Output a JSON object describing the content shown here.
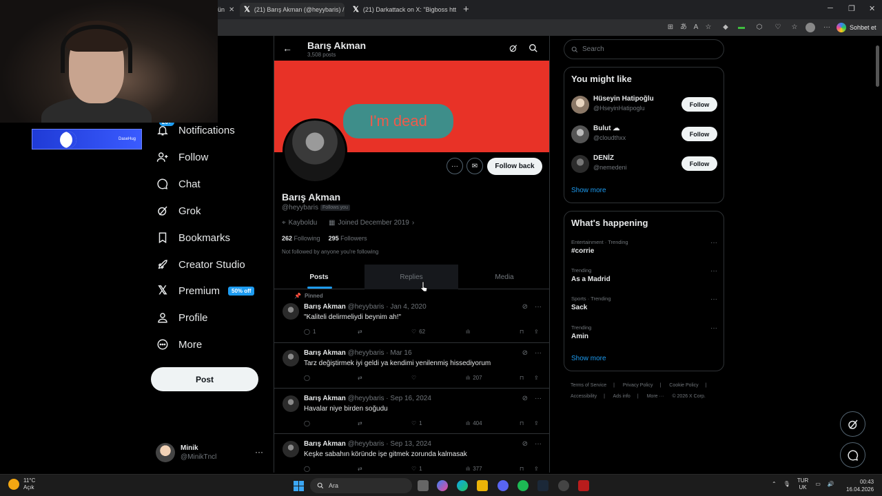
{
  "browser": {
    "tabs": [
      {
        "label": "ün"
      },
      {
        "label": "(21) Barış Akman (@heyybaris) / X"
      },
      {
        "label": "(21) Darkattack on X: \"Bigboss htt"
      }
    ],
    "copilot_label": "Sohbet et"
  },
  "stream_banner": {
    "text": "DaseHug"
  },
  "nav": {
    "notifications_badge": "20+",
    "items": [
      {
        "label": "Notifications",
        "icon": "bell-icon"
      },
      {
        "label": "Follow",
        "icon": "person-plus-icon"
      },
      {
        "label": "Chat",
        "icon": "chat-bubble-icon"
      },
      {
        "label": "Grok",
        "icon": "grok-icon"
      },
      {
        "label": "Bookmarks",
        "icon": "bookmark-icon"
      },
      {
        "label": "Creator Studio",
        "icon": "rocket-icon"
      },
      {
        "label": "Premium",
        "icon": "x-logo-icon"
      },
      {
        "label": "Profile",
        "icon": "person-icon"
      },
      {
        "label": "More",
        "icon": "more-circle-icon"
      }
    ],
    "premium_promo": "50% off",
    "post_label": "Post",
    "account": {
      "name": "Minik",
      "handle": "@MinikTncl"
    }
  },
  "profile": {
    "header_name": "Barış Akman",
    "header_posts": "3,508 posts",
    "banner_text": "I'm dead",
    "follow_back_label": "Follow back",
    "name": "Barış Akman",
    "handle": "@heyybaris",
    "follows_you": "Follows you",
    "location": "Kayboldu",
    "joined": "Joined December 2019",
    "following_count": "262",
    "following_label": "Following",
    "followers_count": "295",
    "followers_label": "Followers",
    "not_followed": "Not followed by anyone you're following",
    "tabs": [
      "Posts",
      "Replies",
      "Media"
    ]
  },
  "posts": [
    {
      "pinned": "Pinned",
      "name": "Barış Akman",
      "handle": "@heyybaris",
      "date": "· Jan 4, 2020",
      "text": "\"Kaliteli delirmeliydi beynim ah!\"",
      "replies": "1",
      "likes": "62",
      "views": ""
    },
    {
      "name": "Barış Akman",
      "handle": "@heyybaris",
      "date": "· Mar 16",
      "text": "Tarz değiştirmek iyi geldi ya kendimi yenilenmiş hissediyorum",
      "replies": "",
      "likes": "",
      "views": "207"
    },
    {
      "name": "Barış Akman",
      "handle": "@heyybaris",
      "date": "· Sep 16, 2024",
      "text": "Havalar niye birden soğudu",
      "replies": "",
      "likes": "1",
      "views": "404"
    },
    {
      "name": "Barış Akman",
      "handle": "@heyybaris",
      "date": "· Sep 13, 2024",
      "text": "Keşke sabahın köründe işe gitmek zorunda kalmasak",
      "replies": "",
      "likes": "1",
      "views": "377"
    }
  ],
  "right": {
    "search_placeholder": "Search",
    "might_like_title": "You might like",
    "suggestions": [
      {
        "name": "Hüseyin Hatipoğlu",
        "handle": "@HseyinHatipoglu",
        "button": "Follow"
      },
      {
        "name": "Bulut ☁",
        "handle": "@cloudthxx",
        "button": "Follow"
      },
      {
        "name": "DENİZ",
        "handle": "@nemedeni",
        "button": "Follow"
      }
    ],
    "show_more": "Show more",
    "happening_title": "What's happening",
    "trends": [
      {
        "context": "Entertainment · Trending",
        "name": "#corrie"
      },
      {
        "context": "Trending",
        "name": "As a Madrid"
      },
      {
        "context": "Sports · Trending",
        "name": "Sack"
      },
      {
        "context": "Trending",
        "name": "Amin"
      }
    ],
    "footer": [
      "Terms of Service",
      "|",
      "Privacy Policy",
      "|",
      "Cookie Policy",
      "|",
      "Accessibility",
      "|",
      "Ads info",
      "|",
      "More ···",
      "© 2026 X Corp."
    ]
  },
  "taskbar": {
    "weather_temp": "11°C",
    "weather_desc": "Açık",
    "search_label": "Ara",
    "lang_top": "TUR",
    "lang_bottom": "UK",
    "time": "00:43",
    "date": "16.04.2026"
  }
}
